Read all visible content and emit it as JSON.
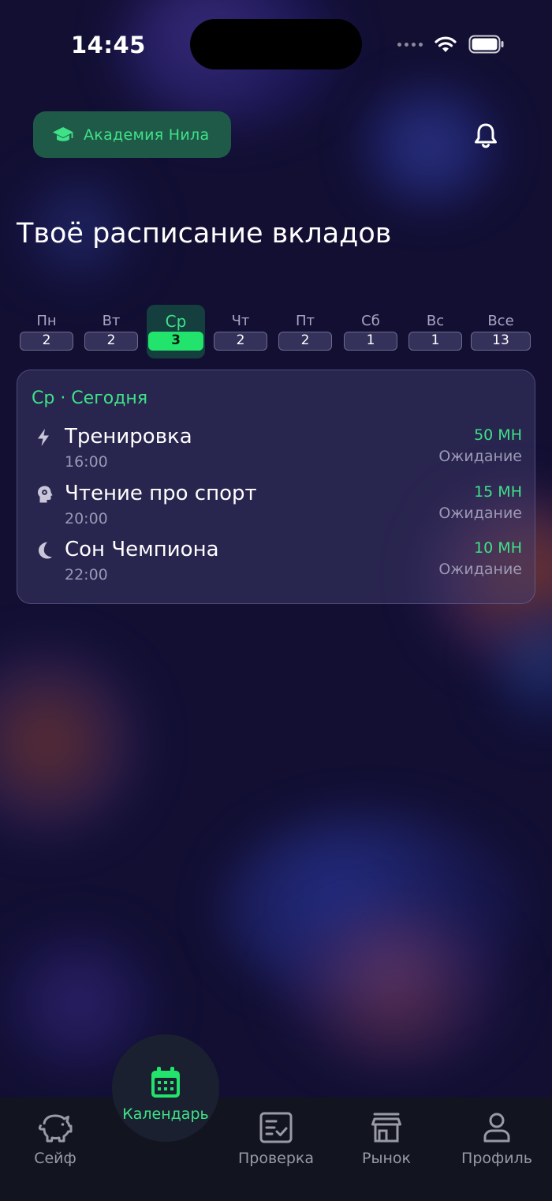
{
  "status_bar": {
    "time": "14:45"
  },
  "header": {
    "academy_label": "Академия Нила"
  },
  "page_title": "Твоё расписание вкладов",
  "days": [
    {
      "name": "Пн",
      "count": "2"
    },
    {
      "name": "Вт",
      "count": "2"
    },
    {
      "name": "Ср",
      "count": "3",
      "active": true
    },
    {
      "name": "Чт",
      "count": "2"
    },
    {
      "name": "Пт",
      "count": "2"
    },
    {
      "name": "Сб",
      "count": "1"
    },
    {
      "name": "Вс",
      "count": "1"
    },
    {
      "name": "Все",
      "count": "13"
    }
  ],
  "schedule": {
    "heading": "Ср · Сегодня",
    "tasks": [
      {
        "name": "Тренировка",
        "time": "16:00",
        "amount": "50 МН",
        "status": "Ожидание",
        "icon": "lightning-icon"
      },
      {
        "name": "Чтение про спорт",
        "time": "20:00",
        "amount": "15 МН",
        "status": "Ожидание",
        "icon": "brain-icon"
      },
      {
        "name": "Сон Чемпиона",
        "time": "22:00",
        "amount": "10 МН",
        "status": "Ожидание",
        "icon": "moon-icon"
      }
    ]
  },
  "nav": {
    "safe": "Сейф",
    "calendar": "Календарь",
    "review": "Проверка",
    "market": "Рынок",
    "profile": "Профиль"
  },
  "colors": {
    "accent": "#3fe287",
    "background": "#120f33",
    "navbar": "#121520"
  }
}
